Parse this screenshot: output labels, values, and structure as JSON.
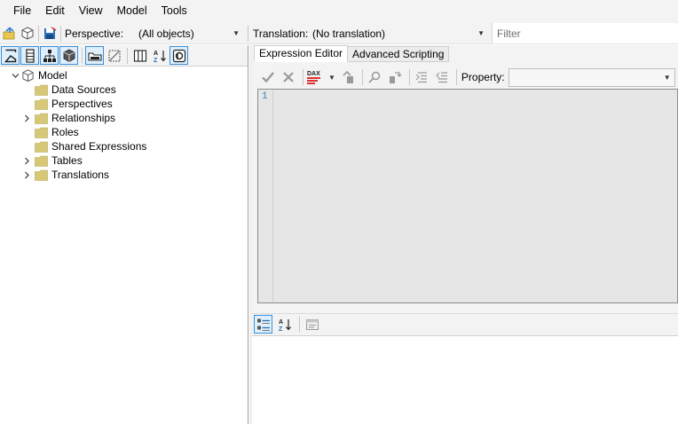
{
  "menu": {
    "items": [
      "File",
      "Edit",
      "View",
      "Model",
      "Tools"
    ]
  },
  "toolbar": {
    "perspective_label": "Perspective:",
    "perspective_value": "(All objects)",
    "translation_label": "Translation:",
    "translation_value": "(No translation)",
    "filter_placeholder": "Filter"
  },
  "tree": {
    "root": "Model",
    "items": [
      {
        "label": "Data Sources",
        "expandable": false
      },
      {
        "label": "Perspectives",
        "expandable": false
      },
      {
        "label": "Relationships",
        "expandable": true
      },
      {
        "label": "Roles",
        "expandable": false
      },
      {
        "label": "Shared Expressions",
        "expandable": false
      },
      {
        "label": "Tables",
        "expandable": true
      },
      {
        "label": "Translations",
        "expandable": true
      }
    ]
  },
  "tabs": [
    {
      "label": "Expression Editor",
      "active": true
    },
    {
      "label": "Advanced Scripting",
      "active": false
    }
  ],
  "editor_toolbar": {
    "dax_label": "DAX",
    "property_label": "Property:",
    "property_value": ""
  },
  "editor": {
    "line_number": "1"
  },
  "colors": {
    "accent": "#3b8fd8",
    "folder": "#d7c877",
    "check": "#9a9a9a"
  }
}
